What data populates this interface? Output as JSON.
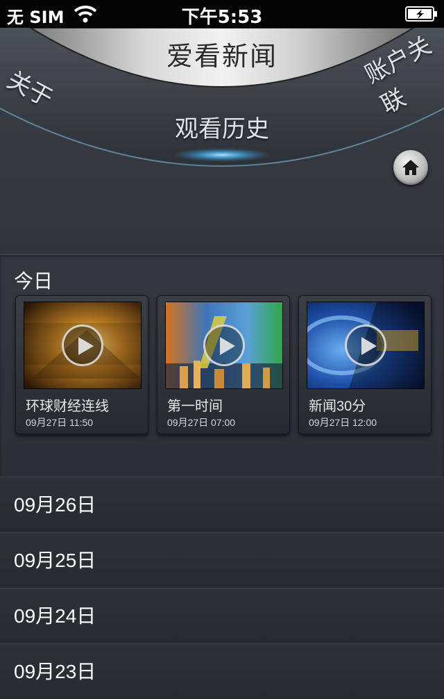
{
  "status_bar": {
    "carrier": "无 SIM",
    "time": "下午5:53"
  },
  "header": {
    "title": "爱看新闻",
    "menu": {
      "about": "关于",
      "account": "账户关联",
      "history": "观看历史"
    }
  },
  "today": {
    "label": "今日",
    "items": [
      {
        "name": "环球财经连线",
        "time": "09月27日 11:50"
      },
      {
        "name": "第一时间",
        "time": "09月27日 07:00"
      },
      {
        "name": "新闻30分",
        "time": "09月27日 12:00"
      }
    ]
  },
  "history_dates": [
    "09月26日",
    "09月25日",
    "09月24日",
    "09月23日"
  ],
  "colors": {
    "background": "#2b3038",
    "status_bar": "#050505",
    "accent_glow": "#5cc6ff"
  }
}
